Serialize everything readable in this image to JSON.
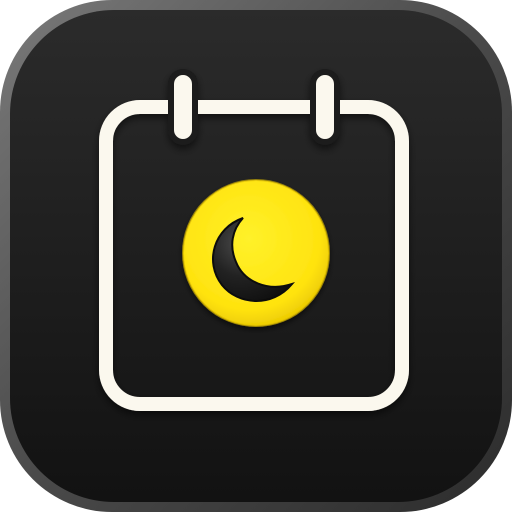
{
  "icon": {
    "name": "calendar-night-app-icon",
    "glyphs": [
      "calendar-icon",
      "moon-icon"
    ],
    "colors": {
      "tile_border": "#5a5a5a",
      "tile_body_top": "#2a2a2a",
      "tile_body_bottom": "#141414",
      "calendar_outline": "#fbf8ee",
      "badge_yellow": "#ffe816",
      "badge_yellow_dark": "#e8c800",
      "moon": "#1b1b1b"
    }
  }
}
